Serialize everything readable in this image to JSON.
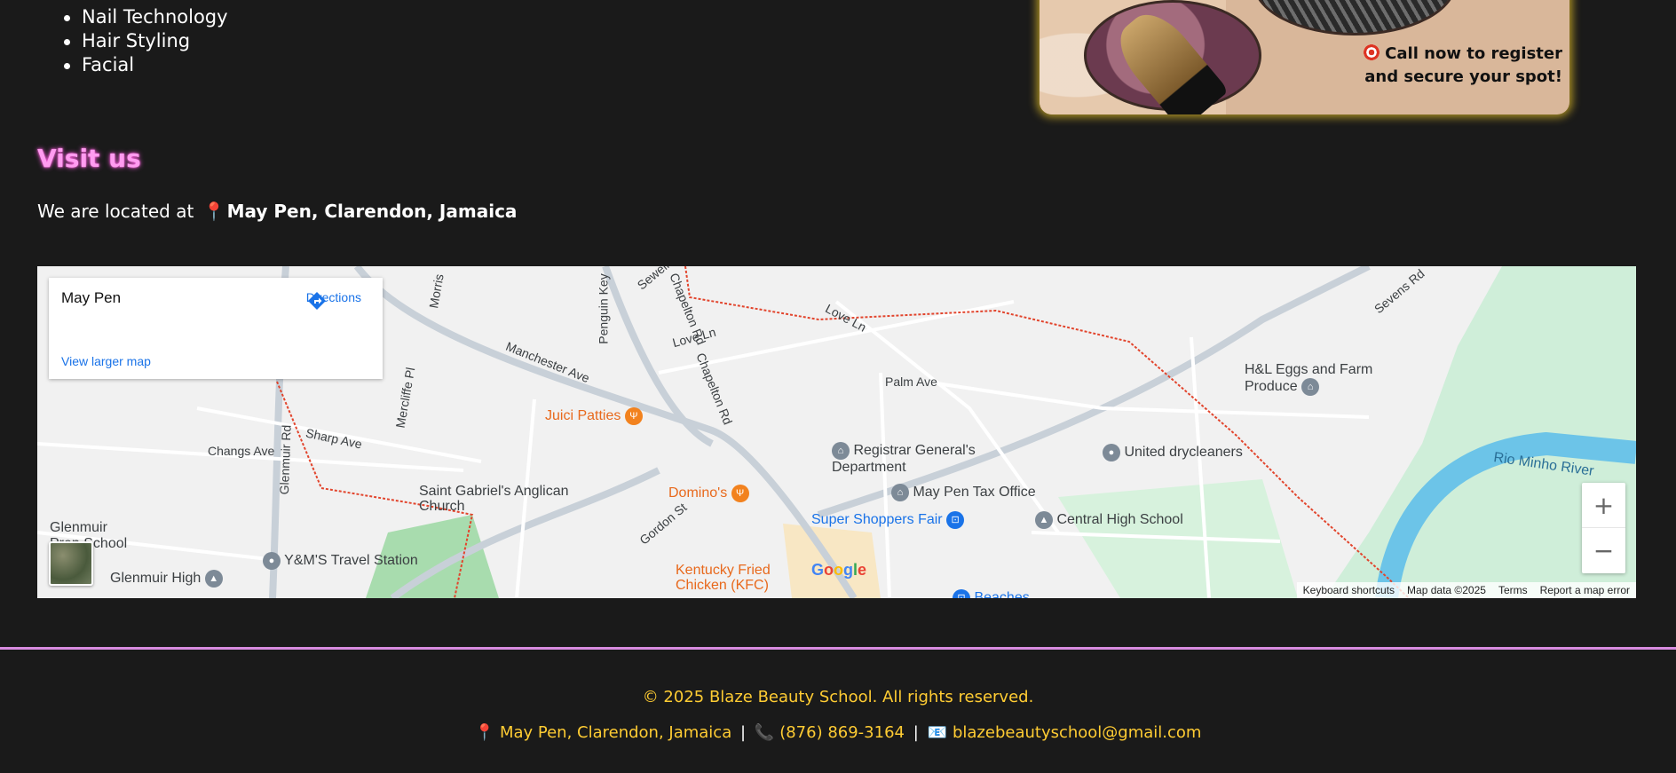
{
  "services": [
    "Nail Technology",
    "Hair Styling",
    "Facial"
  ],
  "promo": {
    "cta_line1": "Call now to register",
    "cta_line2": "and secure your spot!"
  },
  "visit": {
    "title": "Visit us",
    "located_prefix": "We are located at",
    "location": "May Pen, Clarendon, Jamaica"
  },
  "map": {
    "place_name": "May Pen",
    "directions_label": "Directions",
    "larger_map_label": "View larger map",
    "zoom_in": "+",
    "zoom_out": "−",
    "google_logo": "Google",
    "attribution": {
      "shortcuts": "Keyboard shortcuts",
      "map_data": "Map data ©2025",
      "terms": "Terms",
      "report": "Report a map error"
    },
    "pois": [
      {
        "label": "Juici Patties",
        "kind": "food"
      },
      {
        "label": "Domino's",
        "kind": "food"
      },
      {
        "label": "Kentucky Fried Chicken (KFC)",
        "kind": "food"
      },
      {
        "label": "Registrar General's Department",
        "kind": "civic"
      },
      {
        "label": "May Pen Tax Office",
        "kind": "civic"
      },
      {
        "label": "Super Shoppers Fair",
        "kind": "shop"
      },
      {
        "label": "Central High School",
        "kind": "civic"
      },
      {
        "label": "United drycleaners",
        "kind": "civic"
      },
      {
        "label": "H&L Eggs and Farm Produce",
        "kind": "civic"
      },
      {
        "label": "Saint Gabriel's Anglican Church",
        "kind": "civic"
      },
      {
        "label": "Y&M'S Travel Station",
        "kind": "civic"
      },
      {
        "label": "Glenmuir High",
        "kind": "civic"
      },
      {
        "label": "Glenmuir Prep School",
        "kind": "civic"
      },
      {
        "label": "Beaches",
        "kind": "shop"
      }
    ],
    "streets": [
      "Manchester Ave",
      "Chapelton Rd",
      "Chapelton Rd",
      "Penguin Key",
      "Love Ln",
      "Love Ln",
      "Palm Ave",
      "Sharp Ave",
      "Changs Ave",
      "Glenmuir Rd",
      "Mercliffe Pl",
      "Gordon St",
      "Sevens Rd",
      "Sewell",
      "Morris"
    ],
    "river": "Rio Minho River"
  },
  "footer": {
    "copyright": "© 2025 Blaze Beauty School. All rights reserved.",
    "address": "May Pen, Clarendon, Jamaica",
    "phone": "(876) 869-3164",
    "email": "blazebeautyschool@gmail.com",
    "separator": "|"
  },
  "icons": {
    "pin": "📍",
    "phone": "📞",
    "email": "📧",
    "target": "🎯"
  }
}
